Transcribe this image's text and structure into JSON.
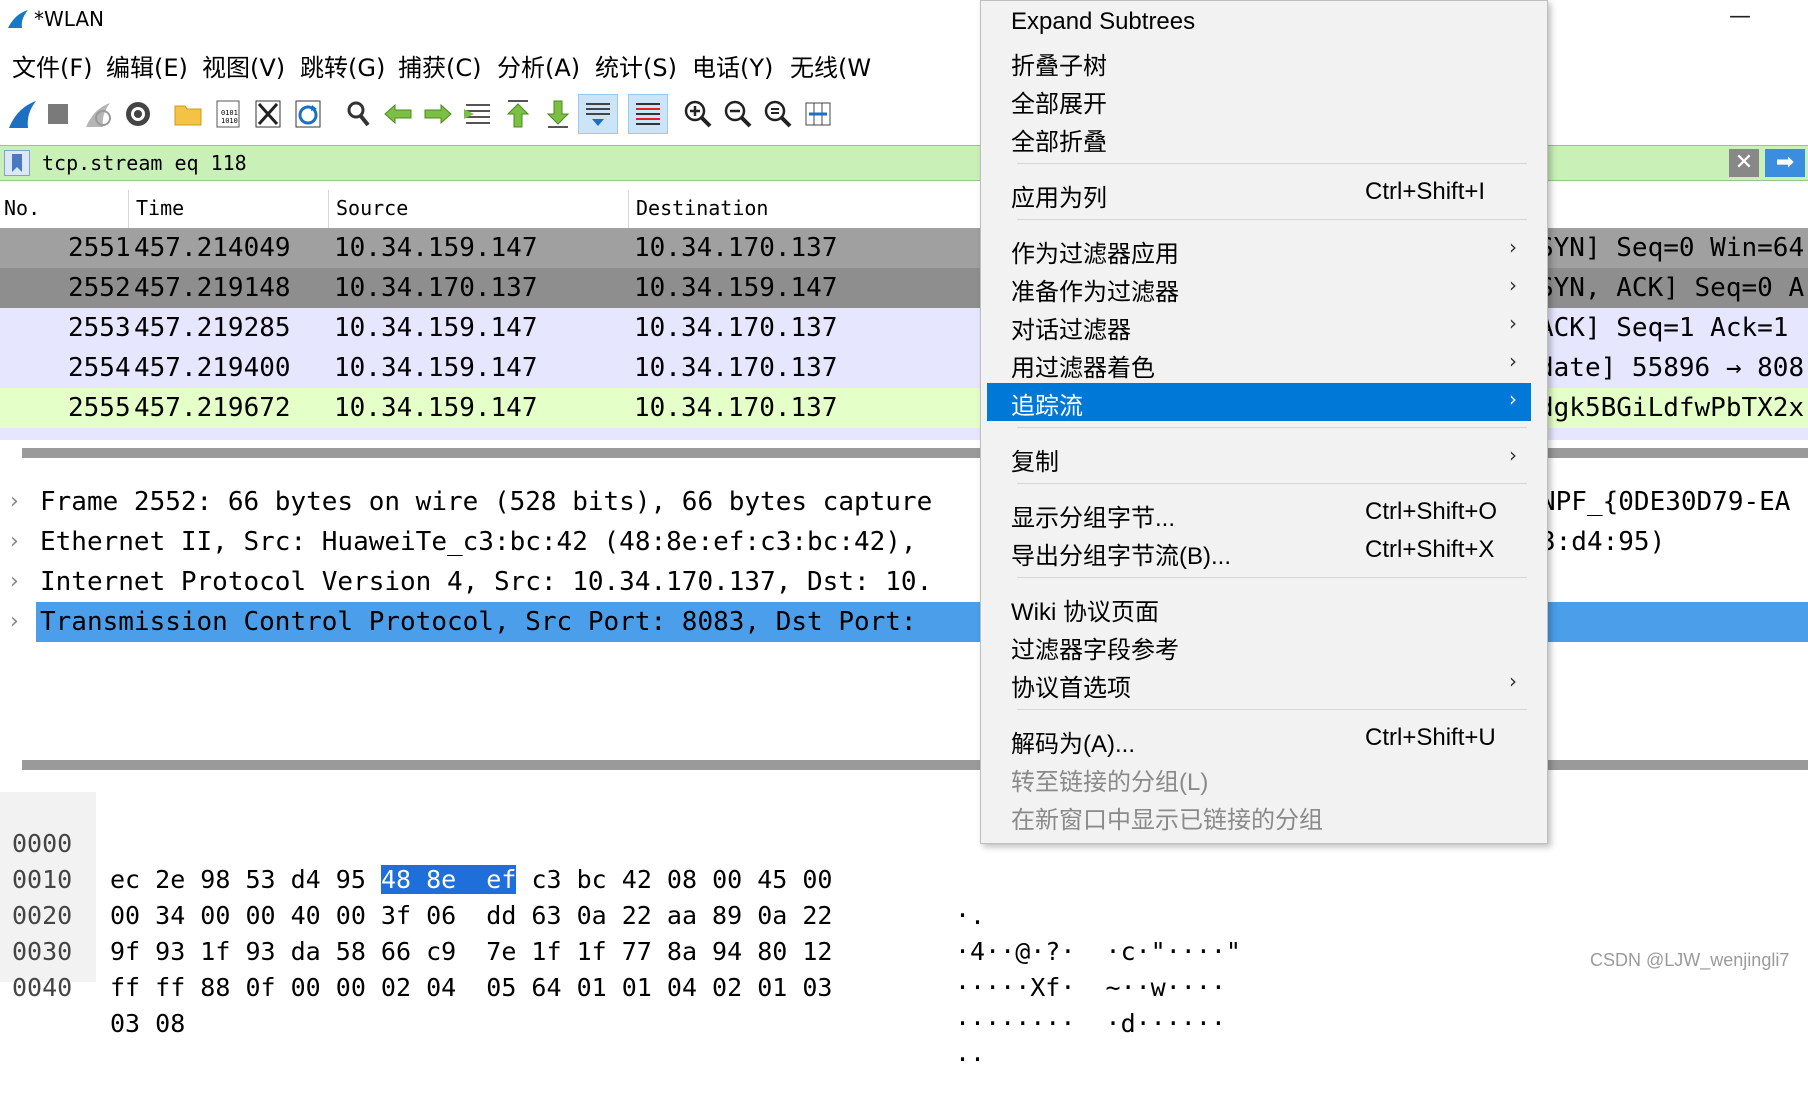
{
  "window": {
    "title": "*WLAN",
    "minimize": "—"
  },
  "menubar": [
    "文件(F)",
    "编辑(E)",
    "视图(V)",
    "跳转(G)",
    "捕获(C)",
    "分析(A)",
    "统计(S)",
    "电话(Y)",
    "无线(W"
  ],
  "toolbar": [
    {
      "name": "start-capture-icon"
    },
    {
      "name": "stop-capture-icon"
    },
    {
      "name": "restart-capture-icon"
    },
    {
      "name": "capture-options-icon"
    },
    {
      "name": "open-file-icon"
    },
    {
      "name": "save-file-icon"
    },
    {
      "name": "close-file-icon"
    },
    {
      "name": "reload-icon"
    },
    {
      "name": "find-packet-icon"
    },
    {
      "name": "go-back-icon"
    },
    {
      "name": "go-forward-icon"
    },
    {
      "name": "go-to-packet-icon"
    },
    {
      "name": "first-packet-icon"
    },
    {
      "name": "last-packet-icon"
    },
    {
      "name": "autoscroll-icon"
    },
    {
      "name": "colorize-icon"
    },
    {
      "name": "zoom-in-icon"
    },
    {
      "name": "zoom-out-icon"
    },
    {
      "name": "normal-size-icon"
    },
    {
      "name": "resize-columns-icon"
    }
  ],
  "filter": {
    "value": "tcp.stream eq 118",
    "clear": "✕",
    "apply": "➡"
  },
  "packet_list": {
    "columns": [
      "No.",
      "Time",
      "Source",
      "Destination"
    ],
    "rows": [
      {
        "no": "2551",
        "time": "457.214049",
        "src": "10.34.159.147",
        "dst": "10.34.170.137",
        "info": "SYN] Seq=0 Win=64",
        "bg": "#a0a0a0"
      },
      {
        "no": "2552",
        "time": "457.219148",
        "src": "10.34.170.137",
        "dst": "10.34.159.147",
        "info": "SYN, ACK] Seq=0 A",
        "bg": "#8e8e8e"
      },
      {
        "no": "2553",
        "time": "457.219285",
        "src": "10.34.159.147",
        "dst": "10.34.170.137",
        "info": "ACK] Seq=1 Ack=1",
        "bg": "#e7e6ff"
      },
      {
        "no": "2554",
        "time": "457.219400",
        "src": "10.34.159.147",
        "dst": "10.34.170.137",
        "info": "date] 55896 → 808",
        "bg": "#e7e6ff"
      },
      {
        "no": "2555",
        "time": "457.219672",
        "src": "10.34.159.147",
        "dst": "10.34.170.137",
        "info": "dgk5BGiLdfwPbTX2x",
        "bg": "#e4ffc7"
      }
    ]
  },
  "details": [
    {
      "text": "Frame 2552: 66 bytes on wire (528 bits), 66 bytes capture",
      "right": "NPF_{0DE30D79-EA",
      "selected": false
    },
    {
      "text": "Ethernet II, Src: HuaweiTe_c3:bc:42 (48:8e:ef:c3:bc:42),",
      "right": "3:d4:95)",
      "selected": false
    },
    {
      "text": "Internet Protocol Version 4, Src: 10.34.170.137, Dst: 10.",
      "right": "",
      "selected": false
    },
    {
      "text": "Transmission Control Protocol, Src Port: 8083, Dst Port:",
      "right": "",
      "selected": true
    }
  ],
  "bytes": [
    {
      "offset": "0000",
      "pre": "ec 2e 98 53 d4 95 ",
      "hl": "48 8e  ef",
      "post": " c3 bc 42 08 00 45 00",
      "ascii": "·."
    },
    {
      "offset": "0010",
      "pre": "00 34 00 00 40 00 3f 06  dd 63 0a 22 aa 89 0a 22",
      "hl": "",
      "post": "",
      "ascii": "·4··@·?·  ·c·\"····\""
    },
    {
      "offset": "0020",
      "pre": "9f 93 1f 93 da 58 66 c9  7e 1f 1f 77 8a 94 80 12",
      "hl": "",
      "post": "",
      "ascii": "·····Xf·  ~··w····"
    },
    {
      "offset": "0030",
      "pre": "ff ff 88 0f 00 00 02 04  05 64 01 01 04 02 01 03",
      "hl": "",
      "post": "",
      "ascii": "········  ·d······"
    },
    {
      "offset": "0040",
      "pre": "03 08",
      "hl": "",
      "post": "",
      "ascii": "··"
    }
  ],
  "context_menu": {
    "items": [
      {
        "label": "Expand Subtrees",
        "shortcut": "",
        "submenu": false
      },
      {
        "label": "折叠子树",
        "shortcut": "",
        "submenu": false
      },
      {
        "label": "全部展开",
        "shortcut": "",
        "submenu": false
      },
      {
        "label": "全部折叠",
        "shortcut": "",
        "submenu": false
      },
      {
        "label": "应用为列",
        "shortcut": "Ctrl+Shift+I",
        "submenu": false
      },
      {
        "label": "作为过滤器应用",
        "shortcut": "",
        "submenu": true
      },
      {
        "label": "准备作为过滤器",
        "shortcut": "",
        "submenu": true
      },
      {
        "label": "对话过滤器",
        "shortcut": "",
        "submenu": true
      },
      {
        "label": "用过滤器着色",
        "shortcut": "",
        "submenu": true
      },
      {
        "label": "追踪流",
        "shortcut": "",
        "submenu": true
      },
      {
        "label": "复制",
        "shortcut": "",
        "submenu": true
      },
      {
        "label": "显示分组字节...",
        "shortcut": "Ctrl+Shift+O",
        "submenu": false
      },
      {
        "label": "导出分组字节流(B)...",
        "shortcut": "Ctrl+Shift+X",
        "submenu": false
      },
      {
        "label": "Wiki 协议页面",
        "shortcut": "",
        "submenu": false
      },
      {
        "label": "过滤器字段参考",
        "shortcut": "",
        "submenu": false
      },
      {
        "label": "协议首选项",
        "shortcut": "",
        "submenu": true
      },
      {
        "label": "解码为(A)...",
        "shortcut": "Ctrl+Shift+U",
        "submenu": false
      },
      {
        "label": "转至链接的分组(L)",
        "shortcut": "",
        "submenu": false
      },
      {
        "label": "在新窗口中显示已链接的分组",
        "shortcut": "",
        "submenu": false
      }
    ],
    "submenu_arrow": "›"
  },
  "watermark": "CSDN @LJW_wenjingli7",
  "colors": {
    "accent": "#0078d7",
    "filter_bg": "#c9f0b7",
    "detail_select": "#4a9eea"
  }
}
